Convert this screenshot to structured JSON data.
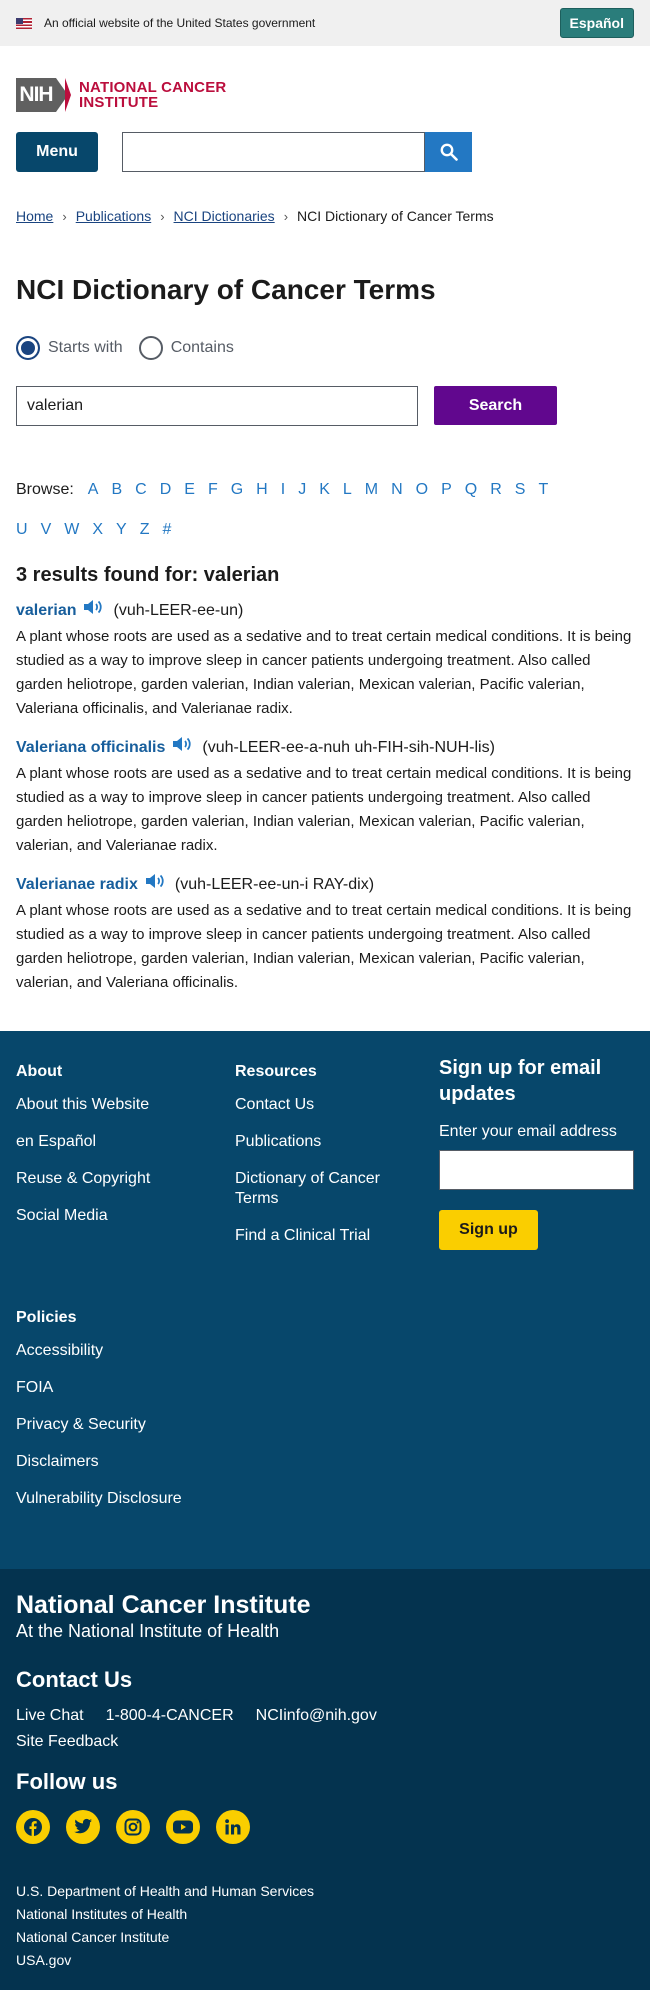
{
  "gov_banner": {
    "text": "An official website of the United States government",
    "espanol": "Español"
  },
  "header": {
    "logo_nih": "NIH",
    "logo_line1": "NATIONAL CANCER",
    "logo_line2": "INSTITUTE",
    "menu_label": "Menu",
    "search_placeholder": ""
  },
  "breadcrumb": {
    "items": [
      "Home",
      "Publications",
      "NCI Dictionaries"
    ],
    "current": "NCI Dictionary of Cancer Terms"
  },
  "page_title": "NCI Dictionary of Cancer Terms",
  "search_form": {
    "option_starts": "Starts with",
    "option_contains": "Contains",
    "selected": "Starts with",
    "query": "valerian",
    "button": "Search"
  },
  "browse": {
    "label": "Browse:",
    "letters": [
      "A",
      "B",
      "C",
      "D",
      "E",
      "F",
      "G",
      "H",
      "I",
      "J",
      "K",
      "L",
      "M",
      "N",
      "O",
      "P",
      "Q",
      "R",
      "S",
      "T",
      "U",
      "V",
      "W",
      "X",
      "Y",
      "Z",
      "#"
    ]
  },
  "results": {
    "heading": "3 results found for: valerian",
    "items": [
      {
        "term": "valerian",
        "pron": "(vuh-LEER-ee-un)",
        "definition": "A plant whose roots are used as a sedative and to treat certain medical conditions. It is being studied as a way to improve sleep in cancer patients undergoing treatment. Also called garden heliotrope, garden valerian, Indian valerian, Mexican valerian, Pacific valerian, Valeriana officinalis, and Valerianae radix."
      },
      {
        "term": "Valeriana officinalis",
        "pron": "(vuh-LEER-ee-a-nuh uh-FIH-sih-NUH-lis)",
        "definition": "A plant whose roots are used as a sedative and to treat certain medical conditions. It is being studied as a way to improve sleep in cancer patients undergoing treatment. Also called garden heliotrope, garden valerian, Indian valerian, Mexican valerian, Pacific valerian, valerian, and Valerianae radix."
      },
      {
        "term": "Valerianae radix",
        "pron": "(vuh-LEER-ee-un-i RAY-dix)",
        "definition": "A plant whose roots are used as a sedative and to treat certain medical conditions. It is being studied as a way to improve sleep in cancer patients undergoing treatment. Also called garden heliotrope, garden valerian, Indian valerian, Mexican valerian, Pacific valerian, valerian, and Valeriana officinalis."
      }
    ]
  },
  "footer": {
    "about": {
      "heading": "About",
      "links": [
        "About this Website",
        "en Español",
        "Reuse & Copyright",
        "Social Media"
      ]
    },
    "resources": {
      "heading": "Resources",
      "links": [
        "Contact Us",
        "Publications",
        "Dictionary of Cancer Terms",
        "Find a Clinical Trial"
      ]
    },
    "signup": {
      "title": "Sign up for email updates",
      "email_label": "Enter your email address",
      "button": "Sign up"
    },
    "policies": {
      "heading": "Policies",
      "links": [
        "Accessibility",
        "FOIA",
        "Privacy & Security",
        "Disclaimers",
        "Vulnerability Disclosure"
      ]
    },
    "institute": {
      "title": "National Cancer Institute",
      "subtitle": "At the National Institute of Health"
    },
    "contact": {
      "heading": "Contact Us",
      "live_chat": "Live Chat",
      "phone": "1-800-4-CANCER",
      "email": "NCIinfo@nih.gov",
      "feedback": "Site Feedback"
    },
    "follow": {
      "heading": "Follow us",
      "icons": [
        "facebook-icon",
        "twitter-icon",
        "instagram-icon",
        "youtube-icon",
        "linkedin-icon"
      ]
    },
    "agencies": [
      "U.S. Department of Health and Human Services",
      "National Institutes of Health",
      "National Cancer Institute",
      "USA.gov"
    ]
  },
  "colors": {
    "menu_bg": "#07476b",
    "search_btn": "#61078e",
    "footer_top": "#07476b",
    "footer_bottom": "#04334f",
    "brand_red": "#bb0e3d",
    "social": "#face00"
  }
}
